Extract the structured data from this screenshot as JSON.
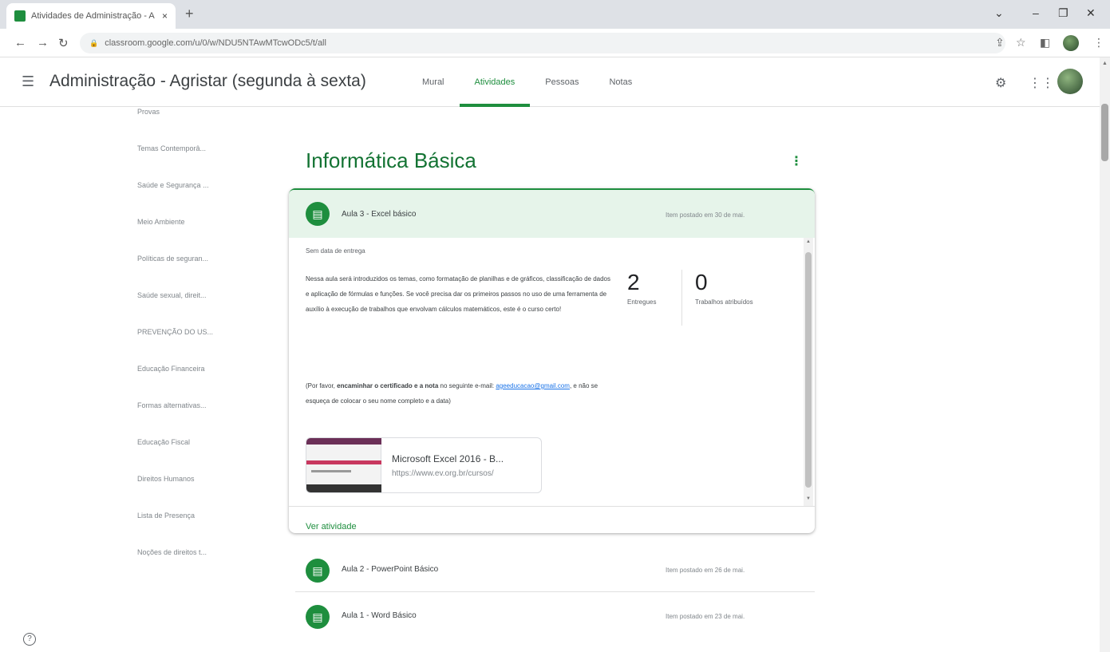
{
  "browser": {
    "tab_title": "Atividades de Administração - A",
    "tab_close": "×",
    "new_tab": "+",
    "url": "classroom.google.com/u/0/w/NDU5NTAwMTcwODc5/t/all",
    "window_controls": [
      "⌄",
      "–",
      "❐",
      "✕"
    ]
  },
  "header": {
    "class_name": "Administração - Agristar (segunda à sexta)",
    "tabs": [
      {
        "label": "Mural",
        "active": false
      },
      {
        "label": "Atividades",
        "active": true
      },
      {
        "label": "Pessoas",
        "active": false
      },
      {
        "label": "Notas",
        "active": false
      }
    ],
    "accent_color": "#1e8e3e"
  },
  "sidebar": {
    "items": [
      "Provas",
      "Temas Contemporâ...",
      "Saúde e Segurança ...",
      "Meio Ambiente",
      "Políticas de seguran...",
      "Saúde sexual, direit...",
      "PREVENÇÃO DO US...",
      "Educação Financeira",
      "Formas alternativas...",
      "Educação Fiscal",
      "Direitos Humanos",
      "Lista de Presença",
      "Noções de direitos t..."
    ]
  },
  "topic": {
    "title": "Informática Básica",
    "menu_icon": "more-vert-icon"
  },
  "expanded": {
    "title": "Aula 3 - Excel básico",
    "date": "Item postado em 30 de mai.",
    "due": "Sem data de entrega",
    "description": "Nessa aula será introduzidos os temas, como formatação de planilhas e de gráficos, classificação de dados e aplicação de fórmulas e funções. Se você precisa dar os primeiros passos no uso de uma ferramenta de auxílio à execução de trabalhos que envolvam cálculos matemáticos, este é o curso certo!",
    "note_prefix": "(Por favor, ",
    "note_bold": "encaminhar o certificado e a nota",
    "note_mid": " no seguinte e-mail: ",
    "note_email": "ageeducacao@gmail.com",
    "note_suffix": ", e não se esqueça de colocar o seu nome completo e a data)",
    "stats": [
      {
        "value": "2",
        "label": "Entregues"
      },
      {
        "value": "0",
        "label": "Trabalhos atribuídos"
      }
    ],
    "attachment": {
      "title": "Microsoft Excel 2016 - B...",
      "url": "https://www.ev.org.br/cursos/"
    },
    "view_label": "Ver atividade"
  },
  "list": [
    {
      "title": "Aula 2 - PowerPoint Básico",
      "date": "Item postado em 26 de mai."
    },
    {
      "title": "Aula 1 - Word Básico",
      "date": "Item postado em 23 de mai."
    }
  ]
}
